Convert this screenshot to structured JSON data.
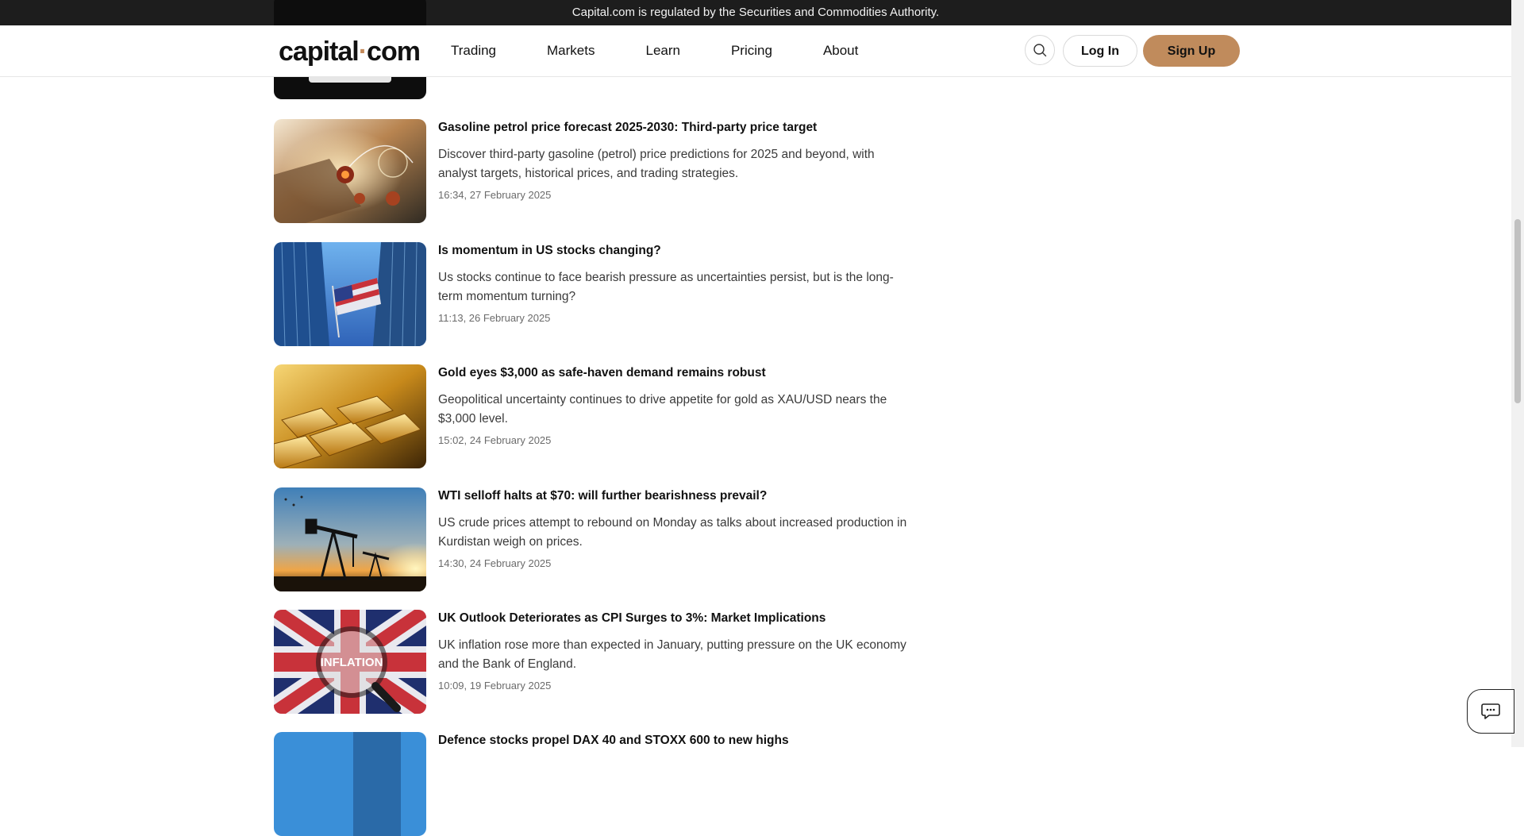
{
  "regulation_banner": "Capital.com is regulated by the Securities and Commodities Authority.",
  "header": {
    "logo_main": "capital",
    "logo_dot": "·",
    "logo_tld": "com",
    "nav": [
      "Trading",
      "Markets",
      "Learn",
      "Pricing",
      "About"
    ],
    "search_icon": "search-icon",
    "login_label": "Log In",
    "signup_label": "Sign Up"
  },
  "colors": {
    "brand_accent": "#c08b5c",
    "banner_bg": "#1d1d1d"
  },
  "articles": [
    {
      "title": "Gasoline petrol price forecast 2025-2030: Third-party price target",
      "description": "Discover third-party gasoline (petrol) price predictions for 2025 and beyond, with analyst targets, historical prices, and trading strategies.",
      "timestamp": "16:34, 27 February 2025"
    },
    {
      "title": "Is momentum in US stocks changing?",
      "description": "Us stocks continue to face bearish pressure as uncertainties persist, but is the long-term momentum turning?",
      "timestamp": "11:13, 26 February 2025"
    },
    {
      "title": "Gold eyes $3,000 as safe-haven demand remains robust",
      "description": "Geopolitical uncertainty continues to drive appetite for gold as XAU/USD nears the $3,000 level.",
      "timestamp": "15:02, 24 February 2025"
    },
    {
      "title": "WTI selloff halts at $70: will further bearishness prevail?",
      "description": "US crude prices attempt to rebound on Monday as talks about increased production in Kurdistan weigh on prices.",
      "timestamp": "14:30, 24 February 2025"
    },
    {
      "title": "UK Outlook Deteriorates as CPI Surges to 3%: Market Implications",
      "description": "UK inflation rose more than expected in January, putting pressure on the UK economy and the Bank of England.",
      "timestamp": "10:09, 19 February 2025"
    },
    {
      "title": "Defence stocks propel DAX 40 and STOXX 600 to new highs",
      "description": "",
      "timestamp": ""
    }
  ],
  "thumbnail_text": {
    "inflation": "INFLATION"
  },
  "chat_icon": "chat-icon"
}
